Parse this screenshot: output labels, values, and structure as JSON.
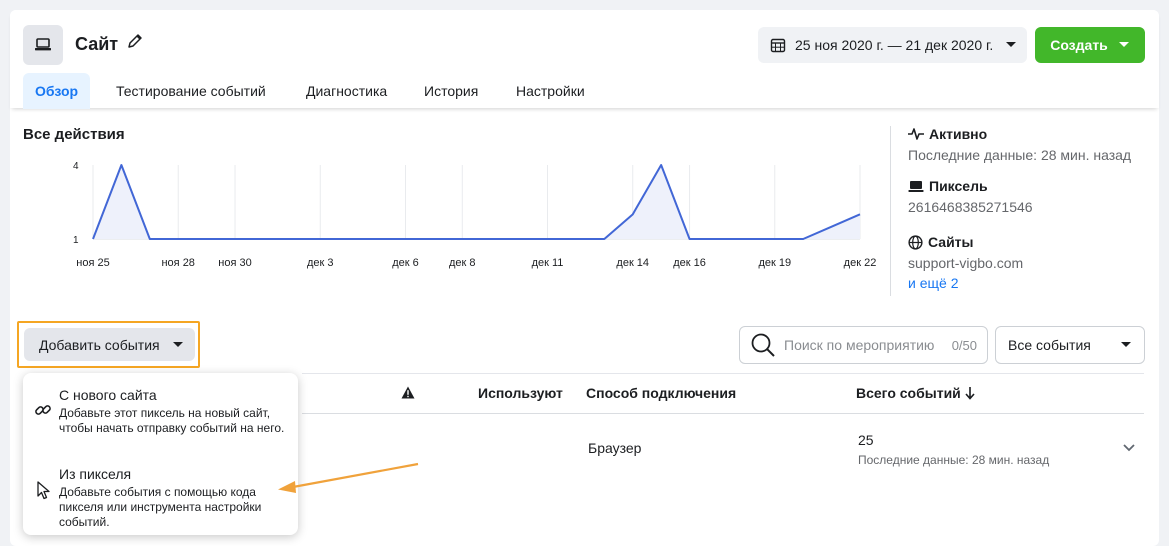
{
  "header": {
    "title": "Сайт",
    "date_range": "25 ноя 2020 г. — 21 дек 2020 г.",
    "create_label": "Создать"
  },
  "tabs": [
    {
      "label": "Обзор",
      "active": true
    },
    {
      "label": "Тестирование событий",
      "active": false
    },
    {
      "label": "Диагностика",
      "active": false
    },
    {
      "label": "История",
      "active": false
    },
    {
      "label": "Настройки",
      "active": false
    }
  ],
  "chart_data": {
    "type": "area",
    "title": "Все действия",
    "x_ticks": [
      "ноя 25",
      "ноя 28",
      "ноя 30",
      "дек 3",
      "дек 6",
      "дек 8",
      "дек 11",
      "дек 14",
      "дек 16",
      "дек 19",
      "дек 22"
    ],
    "y_ticks": [
      "4",
      "1"
    ],
    "ylim": [
      1,
      4
    ],
    "grid": true,
    "x": [
      "2020-11-25",
      "2020-11-26",
      "2020-11-27",
      "2020-11-28",
      "2020-11-29",
      "2020-11-30",
      "2020-12-01",
      "2020-12-02",
      "2020-12-03",
      "2020-12-04",
      "2020-12-05",
      "2020-12-06",
      "2020-12-07",
      "2020-12-08",
      "2020-12-09",
      "2020-12-10",
      "2020-12-11",
      "2020-12-12",
      "2020-12-13",
      "2020-12-14",
      "2020-12-15",
      "2020-12-16",
      "2020-12-17",
      "2020-12-18",
      "2020-12-19",
      "2020-12-20",
      "2020-12-21",
      "2020-12-22"
    ],
    "values": [
      1,
      4,
      1,
      1,
      1,
      1,
      1,
      1,
      1,
      1,
      1,
      1,
      1,
      1,
      1,
      1,
      1,
      1,
      1,
      2,
      4,
      1,
      1,
      1,
      1,
      1,
      1.5,
      2
    ],
    "line_color": "#4267d6",
    "fill_color": "#eef1fb"
  },
  "side": {
    "status_label": "Активно",
    "status_sub": "Последние данные: 28 мин. назад",
    "pixel_label": "Пиксель",
    "pixel_id": "2616468385271546",
    "sites_label": "Сайты",
    "site": "support-vigbo.com",
    "more_link": "и ещё 2"
  },
  "toolbar": {
    "add_events_label": "Добавить события",
    "search_placeholder": "Поиск по мероприятию",
    "search_count": "0/50",
    "filter_label": "Все события"
  },
  "table": {
    "headers": {
      "users": "Используют",
      "method": "Способ подключения",
      "total": "Всего событий"
    },
    "row": {
      "method": "Браузер",
      "total": "25",
      "last": "Последние данные: 28 мин. назад"
    }
  },
  "dropdown": {
    "items": [
      {
        "title": "С нового сайта",
        "desc": "Добавьте этот пиксель на новый сайт, чтобы начать отправку событий на него."
      },
      {
        "title": "Из пикселя",
        "desc": "Добавьте события с помощью кода пикселя или инструмента настройки событий."
      }
    ]
  },
  "colors": {
    "accent": "#1877f2",
    "create": "#42b72a",
    "highlight": "#f5a623"
  }
}
